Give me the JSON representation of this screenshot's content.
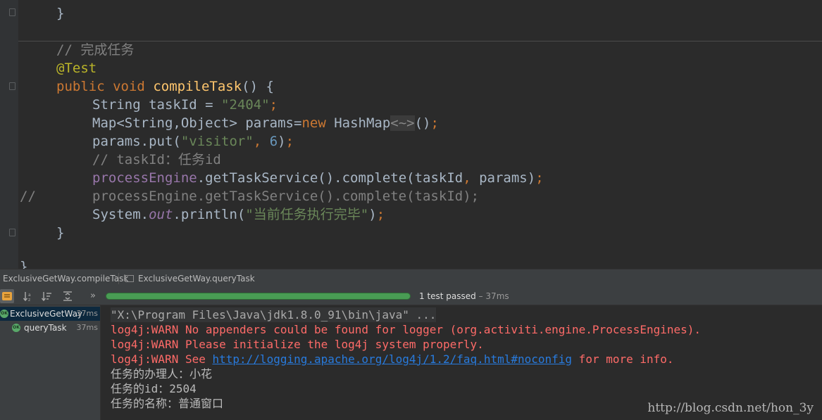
{
  "editor": {
    "line_closing_brace_top": "}",
    "comment_complete_task": "// 完成任务",
    "annotation": "@Test",
    "method": {
      "kw_public": "public",
      "kw_void": "void",
      "name": "compileTask",
      "sig_rest": "() {"
    },
    "stmt_taskid": {
      "type": "String taskId = ",
      "value": "\"2404\"",
      "semi": ";"
    },
    "stmt_map": {
      "decl": "Map<String,",
      "decl2": "Object> params=",
      "kw_new": "new",
      "ctor": " HashMap",
      "diamond": "<~>",
      "rest": "()",
      "semi": ";"
    },
    "stmt_put": {
      "call": "params.put(",
      "key": "\"visitor\"",
      "comma": ", ",
      "num": "6",
      "close": ")",
      "semi": ";"
    },
    "comment_taskid": "// taskId：任务id",
    "stmt_complete": {
      "field": "processEngine",
      "call": ".getTaskService().complete(taskId",
      "comma": ",",
      "args": " params)",
      "semi": ";"
    },
    "commented_line": {
      "prefix": "//",
      "code": "processEngine.getTaskService().complete(taskId);"
    },
    "stmt_println": {
      "sys": "System.",
      "out": "out",
      "call": ".println(",
      "msg": "\"当前任务执行完毕\"",
      "close": ")",
      "semi": ";"
    },
    "line_closing_brace_method": "}",
    "line_closing_brace_class": "}"
  },
  "tabs": [
    {
      "label": "ExclusiveGetWay.compileTask"
    },
    {
      "label": "ExclusiveGetWay.queryTask"
    }
  ],
  "toolbar": {
    "overflow_label": "»",
    "progress_fraction": 1.0,
    "status": "1 test passed",
    "status_time": " – 37ms"
  },
  "test_tree": [
    {
      "name": "ExclusiveGetWay",
      "time": "37ms",
      "badge": "OK"
    },
    {
      "name": "queryTask",
      "time": "37ms",
      "badge": "OK"
    }
  ],
  "console": {
    "cmd": "\"X:\\Program Files\\Java\\jdk1.8.0_91\\bin\\java\" ...",
    "warn1": "log4j:WARN No appenders could be found for logger (org.activiti.engine.ProcessEngines).",
    "warn2": "log4j:WARN Please initialize the log4j system properly.",
    "warn3_prefix": "log4j:WARN See ",
    "warn3_link": "http://logging.apache.org/log4j/1.2/faq.html#noconfig",
    "warn3_suffix": " for more info.",
    "out1": "任务的办理人：小花",
    "out2": "任务的id：2504",
    "out3": "任务的名称：普通窗口"
  },
  "watermark": "http://blog.csdn.net/hon_3y"
}
